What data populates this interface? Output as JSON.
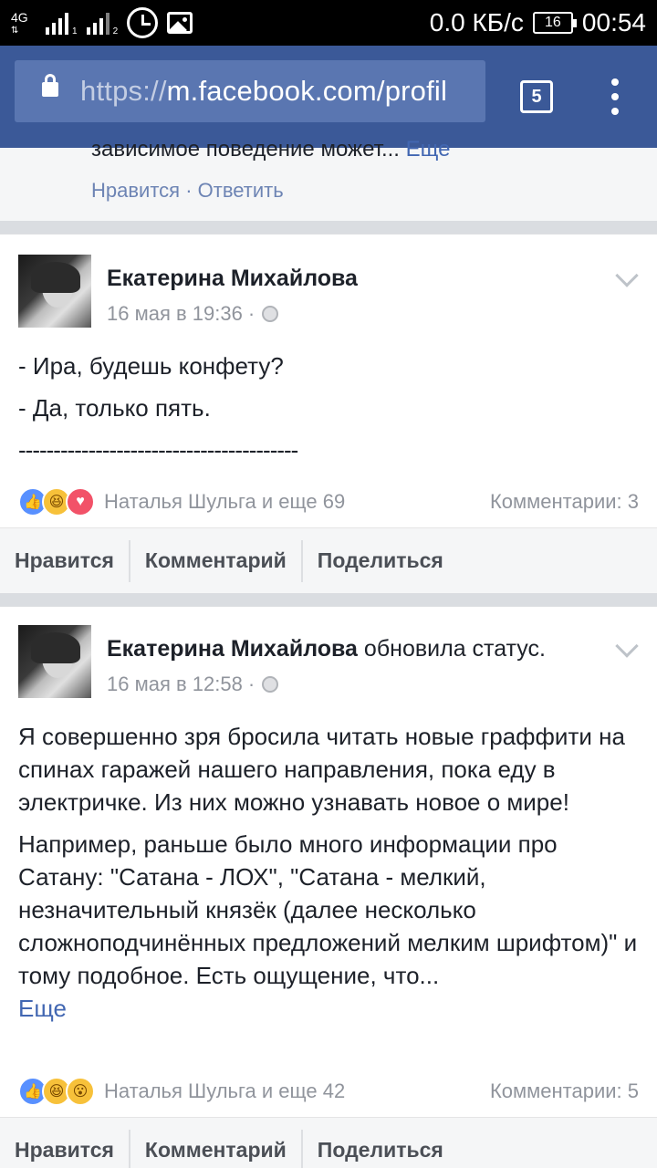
{
  "status_bar": {
    "network": "4G",
    "sim1": "1",
    "sim2": "2",
    "speed": "0.0 КБ/с",
    "battery": "16",
    "time": "00:54",
    "icons": [
      "signal-icon",
      "alarm-icon",
      "gallery-icon",
      "battery-icon"
    ]
  },
  "browser": {
    "url_scheme": "https://",
    "url_rest": "m.facebook.com/profil",
    "tab_count": "5"
  },
  "top_comment": {
    "text": "зависимое поведение может...",
    "more": "Еще",
    "like": "Нравится",
    "dot": " · ",
    "reply": "Ответить"
  },
  "posts": [
    {
      "author": "Екатерина Михайлова",
      "action": "",
      "date": "16 мая в 19:36 ·",
      "paragraphs": [
        "- Ира, будешь конфету?",
        "- Да, только пять.",
        "----------------------------------------"
      ],
      "more": "",
      "reactions": [
        "like",
        "haha",
        "love"
      ],
      "reaction_names": "Наталья Шульга и еще 69",
      "comments": "Комментарии: 3"
    },
    {
      "author": "Екатерина Михайлова",
      "action": "обновила статус.",
      "date": "16 мая в 12:58 ·",
      "paragraphs": [
        "Я совершенно зря бросила читать новые граффити на спинах гаражей нашего направления, пока еду в электричке. Из них можно узнавать новое о мире!",
        "Например, раньше было много информации про Сатану: \"Сатана - ЛОХ\", \"Сатана - мелкий, незначительный князёк (далее несколько сложноподчинённых предложений мелким шрифтом)\" и тому подобное. Есть ощущение, что..."
      ],
      "more": "Еще",
      "reactions": [
        "like",
        "haha",
        "wow"
      ],
      "reaction_names": "Наталья Шульга и еще 42",
      "comments": "Комментарии: 5"
    }
  ],
  "actions": {
    "like": "Нравится",
    "comment": "Комментарий",
    "share": "Поделиться"
  }
}
